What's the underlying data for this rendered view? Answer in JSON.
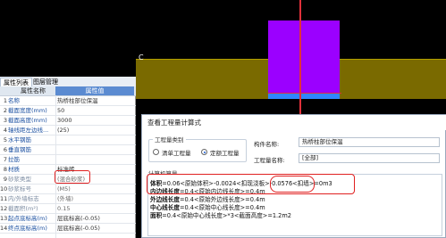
{
  "left_panel": {
    "tabs": [
      "属性列表",
      "图层管理"
    ],
    "header": {
      "name_col": "属性名称",
      "value_col": "属性值"
    },
    "rows": [
      {
        "num": "1",
        "name": "名称",
        "value": "热桥柱部位保温",
        "grey": false
      },
      {
        "num": "2",
        "name": "截面宽度(mm)",
        "value": "50",
        "grey": false
      },
      {
        "num": "3",
        "name": "截面高度(mm)",
        "value": "3000",
        "grey": false
      },
      {
        "num": "4",
        "name": "轴线距左边线...",
        "value": "(25)",
        "grey": false
      },
      {
        "num": "5",
        "name": "水平钢筋",
        "value": "",
        "grey": false
      },
      {
        "num": "6",
        "name": "垂直钢筋",
        "value": "",
        "grey": false
      },
      {
        "num": "7",
        "name": "拉筋",
        "value": "",
        "grey": false
      },
      {
        "num": "8",
        "name": "材质",
        "value": "标准砖",
        "grey": false
      },
      {
        "num": "9",
        "name": "砂浆类型",
        "value": "(混合砂浆)",
        "grey": true
      },
      {
        "num": "10",
        "name": "砂浆标号",
        "value": "(M5)",
        "grey": true
      },
      {
        "num": "11",
        "name": "内/外墙标志",
        "value": "(外墙)",
        "grey": true
      },
      {
        "num": "12",
        "name": "截面积(m²)",
        "value": "0.15",
        "grey": true
      },
      {
        "num": "13",
        "name": "起点底标高(m)",
        "value": "层底标高(-0.05)",
        "grey": false
      },
      {
        "num": "14",
        "name": "终点底标高(m)",
        "value": "层底标高(-0.05)",
        "grey": false
      }
    ]
  },
  "viewport": {
    "axis_label": "C"
  },
  "dialog": {
    "title": "查看工程量计算式",
    "group_label": "工程量类别",
    "radio_list": "清单工程量",
    "radio_quota": "定额工程量",
    "component_label": "构件名称:",
    "component_value": "热桥柱部位保温",
    "quantity_label": "工程量名称:",
    "quantity_value": "[全部]",
    "calc_label": "计算机算量",
    "lines": [
      {
        "key": "体积",
        "expr": "=0.06<原始体积>-0.0024<扣现浇板>-0.0576<扣墙>=0m3"
      },
      {
        "key": "内边线长度",
        "expr": "=0.4<原始内边线长度>=0.4m"
      },
      {
        "key": "外边线长度",
        "expr": "=0.4<原始外边线长度>=0.4m"
      },
      {
        "key": "中心线长度",
        "expr": "=0.4<原始中心线长度>=0.4m"
      },
      {
        "key": "面积",
        "expr": "=0.4<原始中心线长度>*3<截面高度>=1.2m2"
      }
    ]
  },
  "colors": {
    "pillar": "#9b00ff",
    "pillar_base": "#2f86ff",
    "floor": "#7a6a00",
    "annotation": "#e02020",
    "header_accent": "#5b8bd1"
  }
}
